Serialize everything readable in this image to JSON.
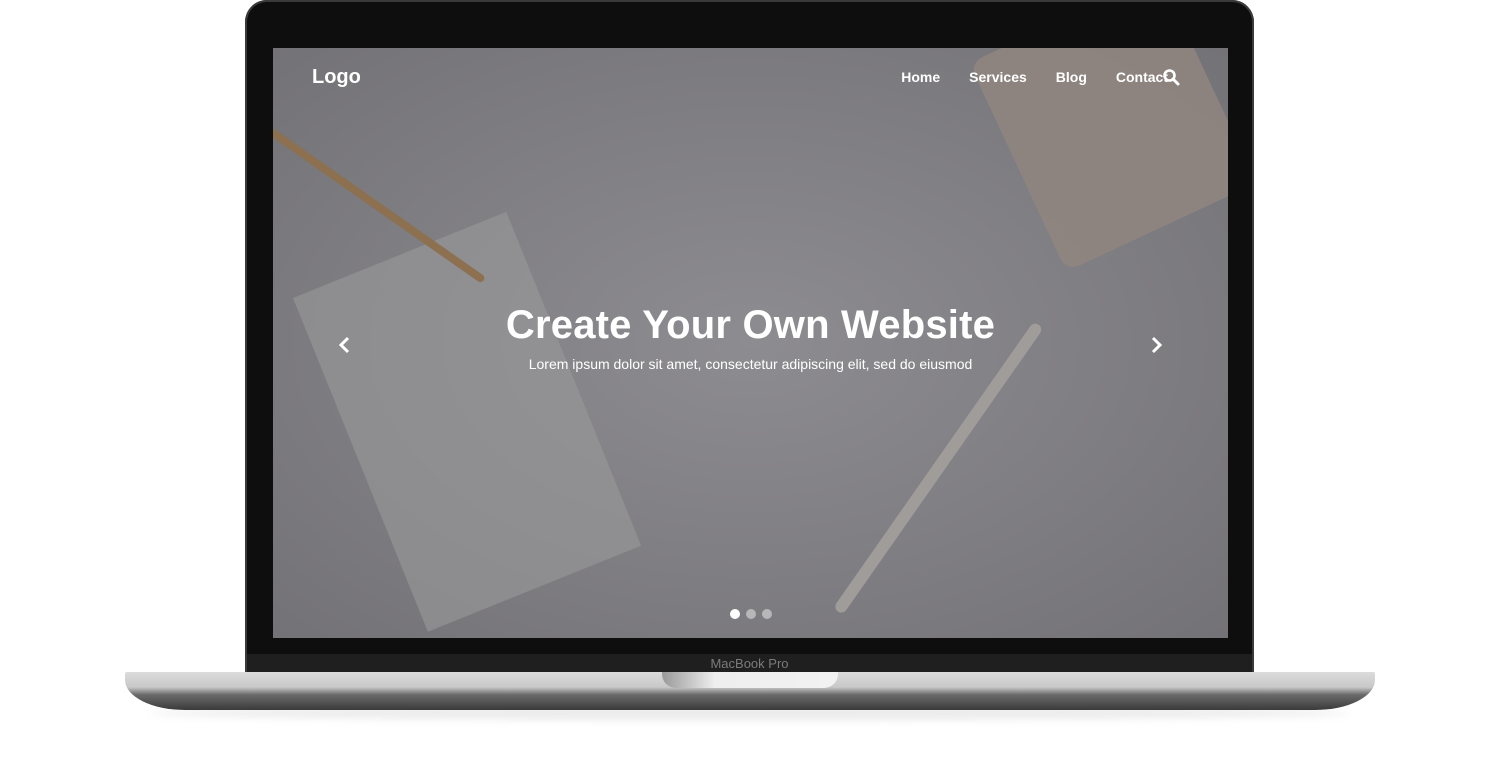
{
  "device": {
    "label": "MacBook Pro"
  },
  "site": {
    "logo": "Logo",
    "nav": [
      {
        "label": "Home"
      },
      {
        "label": "Services"
      },
      {
        "label": "Blog"
      },
      {
        "label": "Contact"
      }
    ],
    "search_icon": "search-icon",
    "hero": {
      "title": "Create Your Own Website",
      "subtitle": "Lorem ipsum dolor sit amet, consectetur adipiscing elit, sed do eiusmod"
    },
    "carousel": {
      "slides": 3,
      "active": 1
    }
  }
}
